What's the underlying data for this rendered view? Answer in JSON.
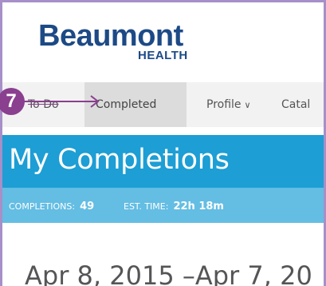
{
  "header": {
    "logo_word": "Beaumont",
    "logo_sub": "HEALTH"
  },
  "nav": {
    "items": [
      {
        "label": "To Do"
      },
      {
        "label": "Completed"
      },
      {
        "label": "Profile",
        "chevron": "∨"
      },
      {
        "label": "Catal"
      }
    ]
  },
  "annotation": {
    "step_number": "7",
    "color": "#8a3f8f"
  },
  "banner": {
    "title": "My Completions"
  },
  "stats": {
    "completions_label": "COMPLETIONS:",
    "completions_value": "49",
    "time_label": "EST. TIME:",
    "time_value": "22h 18m"
  },
  "date_range": {
    "text": "Apr 8, 2015 –Apr 7, 20"
  },
  "colors": {
    "brand": "#1d4a86",
    "banner": "#1d9ed4",
    "stats_bar": "#64bde3",
    "nav_bg": "#f2f2f2",
    "nav_active": "#dcdcdc",
    "frame": "#a78fc8"
  }
}
